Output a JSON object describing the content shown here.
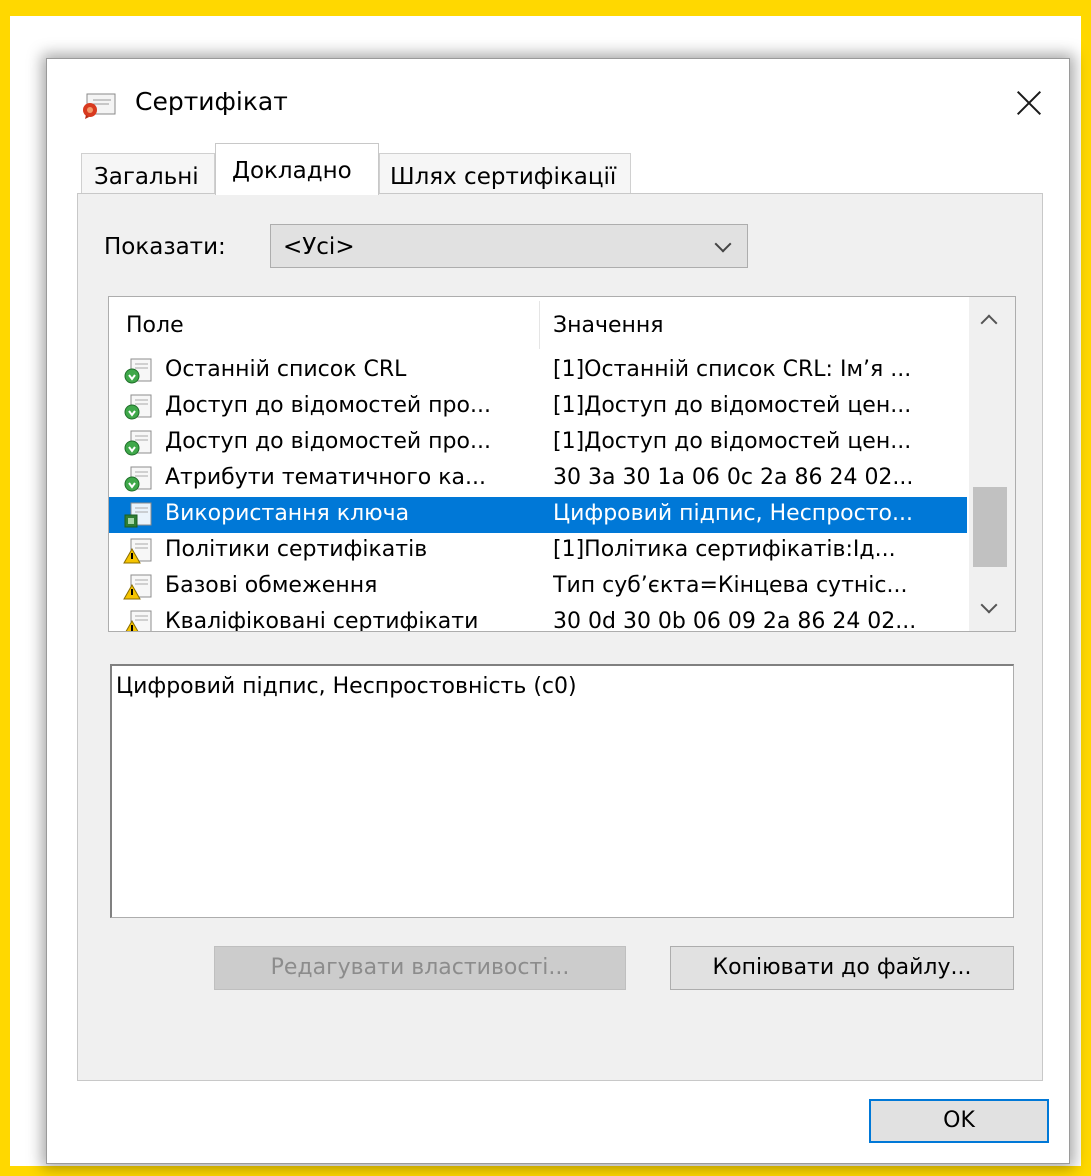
{
  "window": {
    "title": "Сертифікат",
    "title_icon": "certificate-icon"
  },
  "tabs": [
    {
      "label": "Загальні",
      "active": false
    },
    {
      "label": "Докладно",
      "active": true
    },
    {
      "label": "Шлях сертифікації",
      "active": false
    }
  ],
  "show": {
    "label": "Показати:",
    "value": "<Усі>"
  },
  "list": {
    "columns": {
      "field": "Поле",
      "value": "Значення"
    },
    "rows": [
      {
        "field": "Останній список CRL",
        "value": "[1]Останній список CRL: Ім’я ...",
        "icon": "extension-icon",
        "selected": false
      },
      {
        "field": "Доступ до відомостей про...",
        "value": "[1]Доступ до відомостей цен...",
        "icon": "extension-icon",
        "selected": false
      },
      {
        "field": "Доступ до відомостей про...",
        "value": "[1]Доступ до відомостей цен...",
        "icon": "extension-icon",
        "selected": false
      },
      {
        "field": "Атрибути тематичного ка...",
        "value": "30 3a 30 1a 06 0c 2a 86 24 02...",
        "icon": "extension-icon",
        "selected": false
      },
      {
        "field": "Використання ключа",
        "value": "Цифровий підпис, Неспросто...",
        "icon": "critical-extension-icon",
        "selected": true
      },
      {
        "field": "Політики сертифікатів",
        "value": "[1]Політика сертифікатів:Ід...",
        "icon": "warning-extension-icon",
        "selected": false
      },
      {
        "field": "Базові обмеження",
        "value": "Тип суб’єкта=Кінцева сутніс...",
        "icon": "warning-extension-icon",
        "selected": false
      },
      {
        "field": "Кваліфіковані сертифікати",
        "value": "30 0d 30 0b 06 09 2a 86 24 02...",
        "icon": "warning-extension-icon",
        "selected": false
      }
    ]
  },
  "detail": {
    "text": "Цифровий підпис, Неспростовність (c0)"
  },
  "buttons": {
    "edit": "Редагувати властивості...",
    "copy": "Копіювати до файлу...",
    "ok": "OK"
  },
  "colors": {
    "background": "#ffd800",
    "selection": "#0078d7"
  }
}
